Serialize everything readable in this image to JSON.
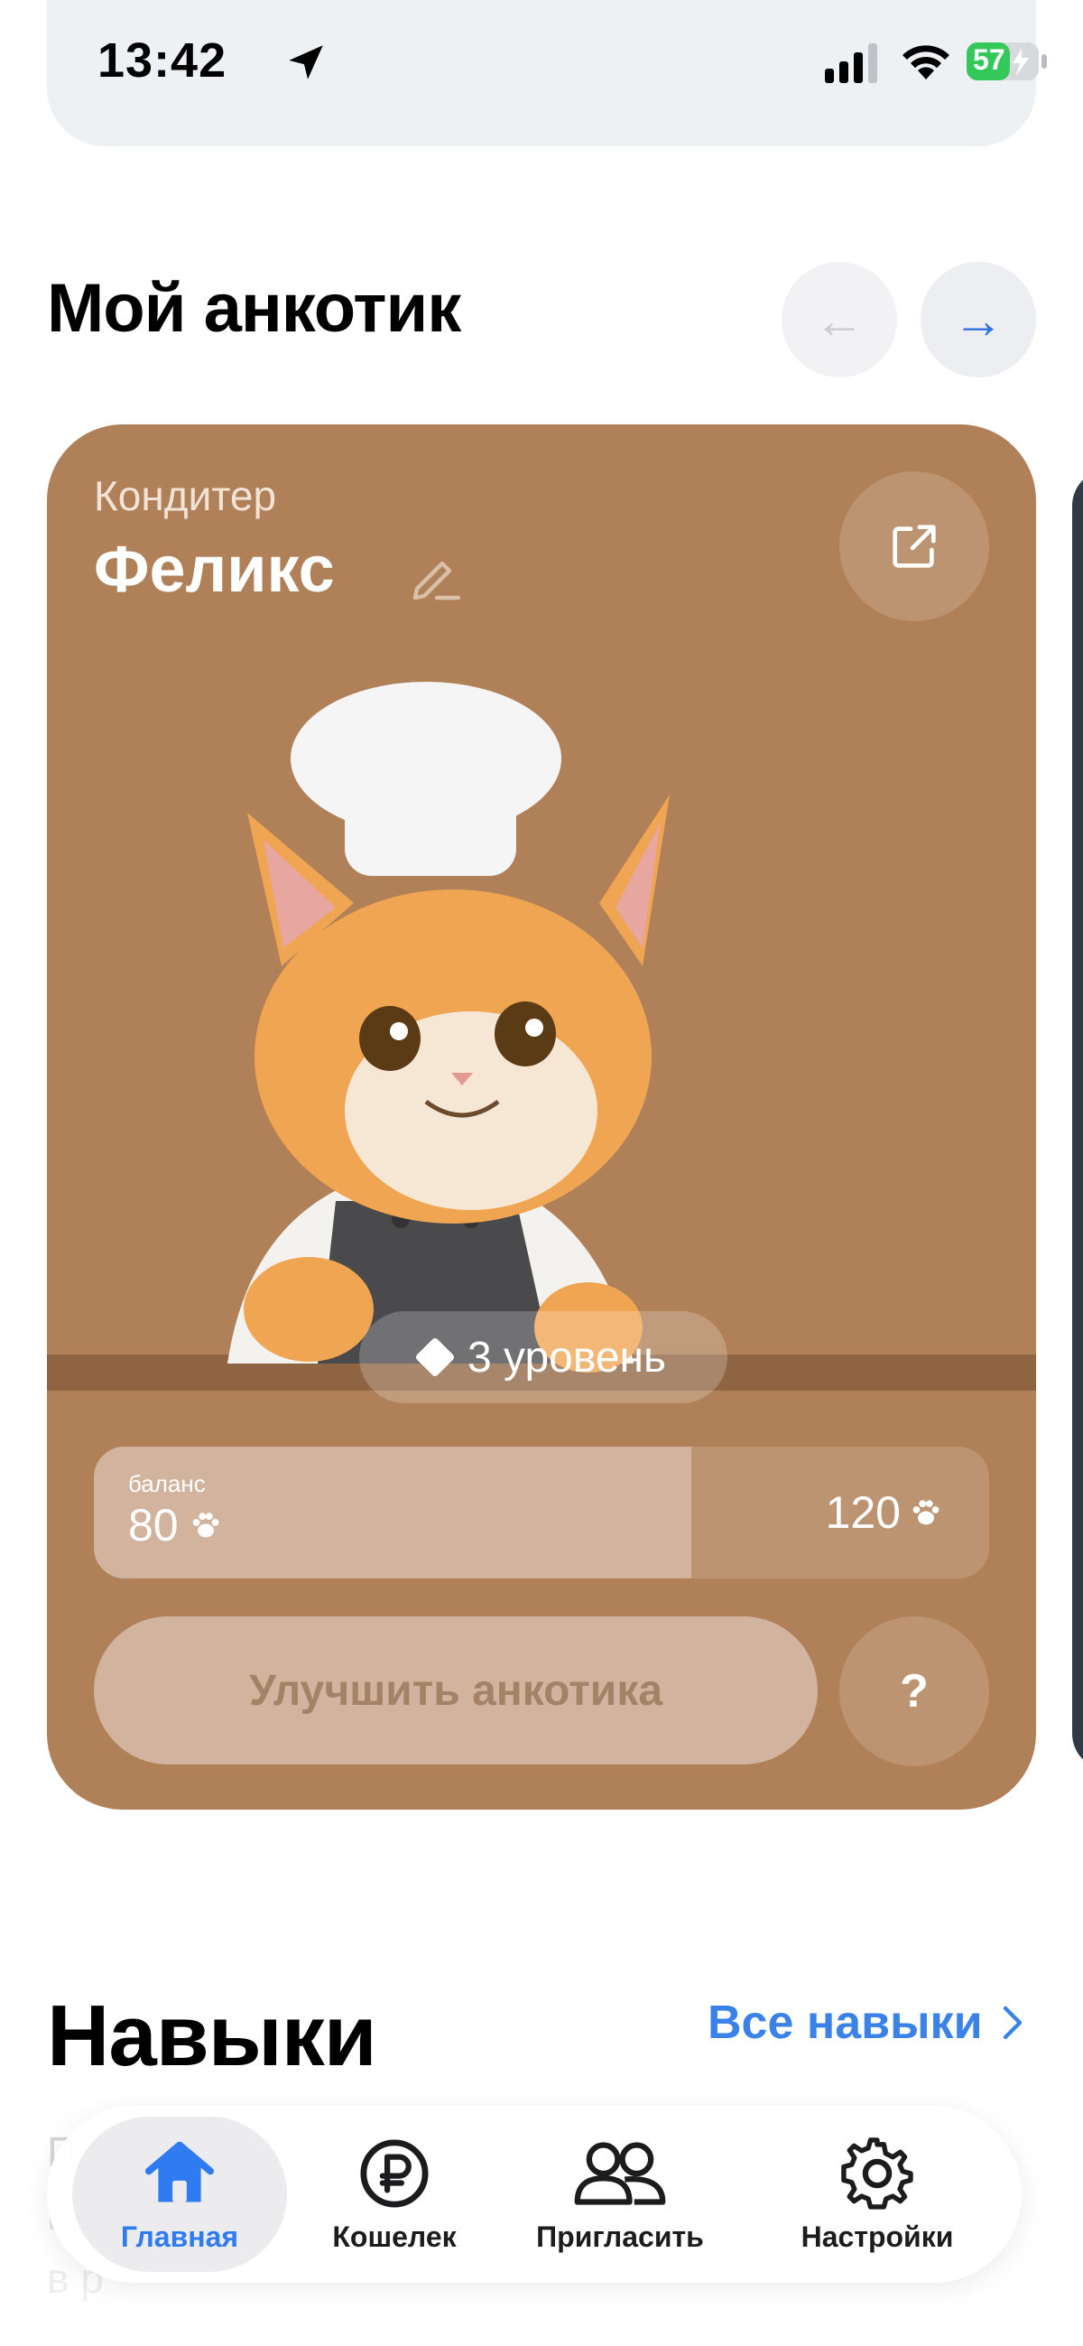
{
  "status_bar": {
    "time": "13:42",
    "battery": "57"
  },
  "header": {
    "title": "Мой анкотик",
    "prev_icon": "arrow-left",
    "next_icon": "arrow-right"
  },
  "pet_card": {
    "role": "Кондитер",
    "name": "Феликс",
    "level_label": "3 уровень",
    "balance_label": "баланс",
    "balance_value": "80",
    "balance_max": "120",
    "balance_progress": 0.667,
    "upgrade_label": "Улучшить анкотика",
    "help_label": "?",
    "card_color": "#b08058"
  },
  "skills": {
    "title": "Навыки",
    "link_label": "Все навыки",
    "desc_line_1": "П",
    "desc_line_2": "в",
    "desc_line_3": "в р"
  },
  "tab_bar": {
    "items": [
      {
        "label": "Главная",
        "icon": "home-icon",
        "active": true
      },
      {
        "label": "Кошелек",
        "icon": "ruble-icon",
        "active": false
      },
      {
        "label": "Пригласить",
        "icon": "people-icon",
        "active": false
      },
      {
        "label": "Настройки",
        "icon": "gear-icon",
        "active": false
      }
    ],
    "accent": "#2f7bf1"
  }
}
